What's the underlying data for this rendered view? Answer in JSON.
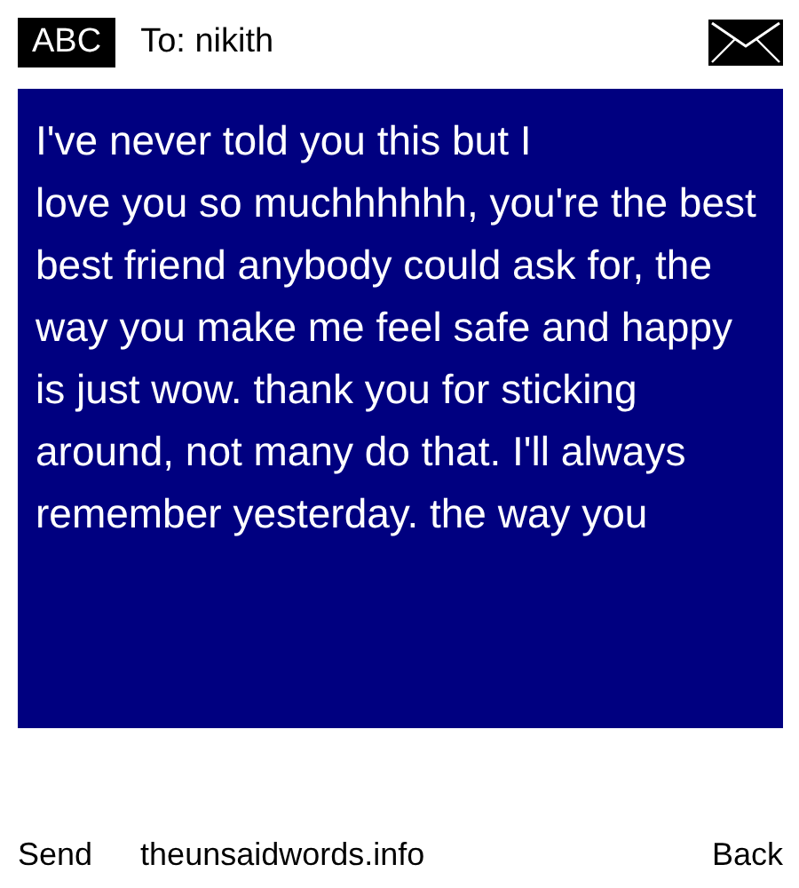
{
  "header": {
    "badge": "ABC",
    "recipient": "To: nikith"
  },
  "message": {
    "text": "I've never told you this but I\nlove you so muchhhhhh, you're the best best friend anybody could ask for, the way you make me feel safe and happy is just wow. thank you for sticking around, not many do that. I'll always remember yesterday. the way you"
  },
  "footer": {
    "send": "Send",
    "site": "theunsaidwords.info",
    "back": "Back"
  }
}
